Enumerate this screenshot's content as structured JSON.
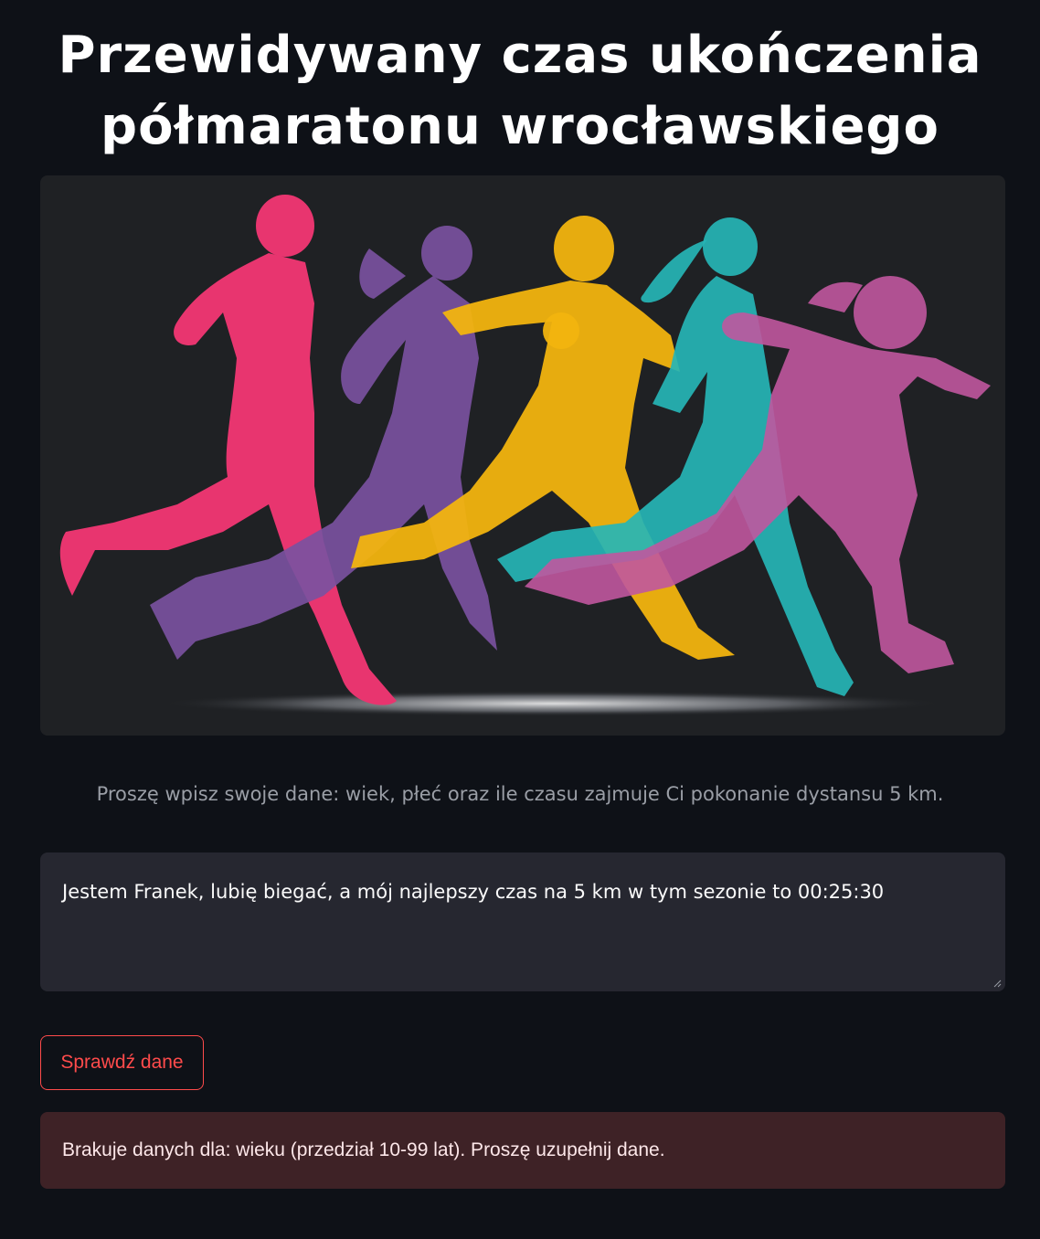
{
  "header": {
    "title_line1": "Przewidywany czas ukończenia",
    "title_line2": "półmaratonu wrocławskiego"
  },
  "hero": {
    "icon": "runners-illustration",
    "colors": [
      "#e8356f",
      "#7a519f",
      "#f2b40f",
      "#26b5b6",
      "#c0569e"
    ]
  },
  "form": {
    "instructions": "Proszę wpisz swoje dane: wiek, płeć oraz ile czasu zajmuje Ci pokonanie dystansu 5 km.",
    "input_value": "Jestem Franek, lubię biegać, a mój najlepszy czas na 5 km w tym sezonie to 00:25:30",
    "submit_label": "Sprawdź dane"
  },
  "alert": {
    "message": "Brakuje danych dla: wieku (przedział 10-99 lat). Proszę uzupełnij dane."
  },
  "theme": {
    "background": "#0e1117",
    "accent": "#ff4b4b",
    "error_bg": "#3e2226"
  }
}
